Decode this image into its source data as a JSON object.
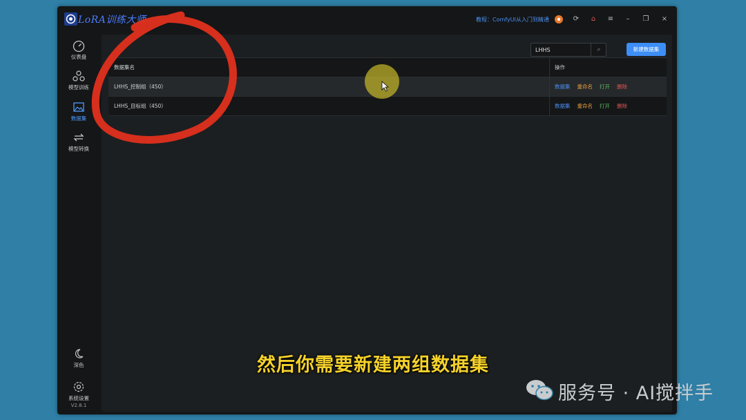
{
  "app": {
    "title": "LoRA训练大师",
    "tutorial_link": "教程：ComfyUI从入门到精通"
  },
  "sidebar": {
    "items": [
      {
        "label": "仪表盘",
        "icon": "dashboard-icon"
      },
      {
        "label": "模型训练",
        "icon": "model-train-icon"
      },
      {
        "label": "数据集",
        "icon": "dataset-icon",
        "active": true
      },
      {
        "label": "模型转换",
        "icon": "convert-icon"
      }
    ],
    "bottom": [
      {
        "label": "深色",
        "icon": "moon-icon"
      },
      {
        "label": "系统设置",
        "icon": "gear-icon"
      }
    ],
    "version": "V2.8.1"
  },
  "toolbar": {
    "search_value": "LHHS",
    "new_button": "新建数据集"
  },
  "table": {
    "headers": [
      "数据集名",
      "操作"
    ],
    "rows": [
      {
        "name": "LHHS_控制组（450）"
      },
      {
        "name": "LHHS_目标组（450）"
      }
    ],
    "actions": [
      "数据集",
      "重命名",
      "打开",
      "删除"
    ]
  },
  "overlay": {
    "subtitle": "然后你需要新建两组数据集",
    "watermark": "服务号 · AI搅拌手"
  },
  "colors": {
    "accent": "#3d8ef5",
    "annotation_circle": "#e0301e",
    "subtitle": "#f5d22a"
  }
}
